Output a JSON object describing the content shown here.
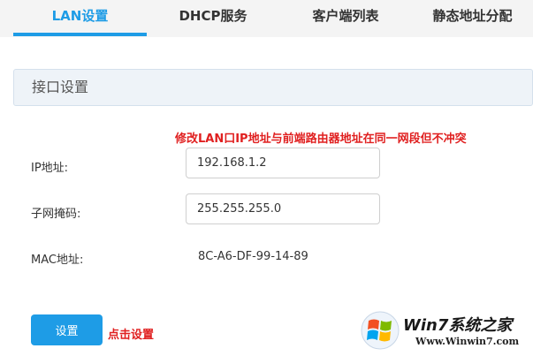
{
  "tabs": [
    {
      "label": "LAN设置",
      "active": true
    },
    {
      "label": "DHCP服务",
      "active": false
    },
    {
      "label": "客户端列表",
      "active": false
    },
    {
      "label": "静态地址分配",
      "active": false
    }
  ],
  "section": {
    "title": "接口设置"
  },
  "warning_text": "修改LAN口IP地址与前端路由器地址在同一网段但不冲突",
  "fields": {
    "ip": {
      "label": "IP地址:",
      "value": "192.168.1.2"
    },
    "subnet": {
      "label": "子网掩码:",
      "value": "255.255.255.0"
    },
    "mac": {
      "label": "MAC地址:",
      "value": "8C-A6-DF-99-14-89"
    }
  },
  "set_button": {
    "label": "设置"
  },
  "click_hint": "点击设置",
  "watermark": {
    "brand": "Win7系统之家",
    "url": "Www.Winwin7.com"
  },
  "colors": {
    "accent": "#1e9ce6",
    "warning": "#e02020"
  }
}
